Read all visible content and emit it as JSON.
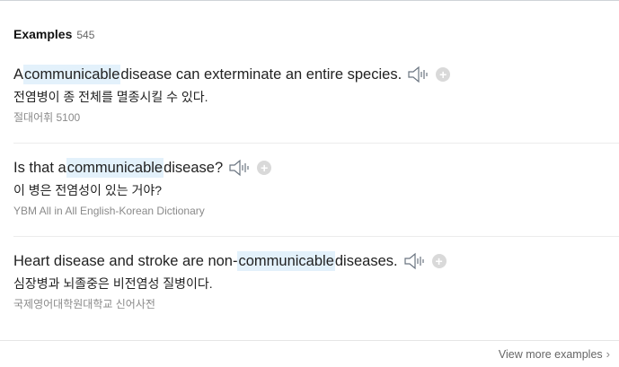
{
  "header": {
    "title": "Examples",
    "count": "545"
  },
  "examples": [
    {
      "before": "A ",
      "highlight": "communicable",
      "after": " disease can exterminate an entire species.",
      "translation": "전염병이 종 전체를 멸종시킬 수 있다.",
      "source": "절대어휘 5100"
    },
    {
      "before": "Is that a ",
      "highlight": "communicable",
      "after": " disease?",
      "translation": "이 병은 전염성이 있는 거야?",
      "source": "YBM All in All English-Korean Dictionary"
    },
    {
      "before": "Heart disease and stroke are non-",
      "highlight": "communicable",
      "after": " diseases.",
      "translation": "심장병과 뇌졸중은 비전염성 질병이다.",
      "source": "국제영어대학원대학교 신어사전"
    }
  ],
  "footer": {
    "more_label": "View more examples"
  },
  "icons": {
    "audio": "speaker-icon",
    "add": "plus-circle-icon",
    "more": "chevron-right-icon"
  },
  "colors": {
    "highlight": "#e3f1fb",
    "source_text": "#8a8a8a",
    "add_button": "#d9d9d9"
  }
}
